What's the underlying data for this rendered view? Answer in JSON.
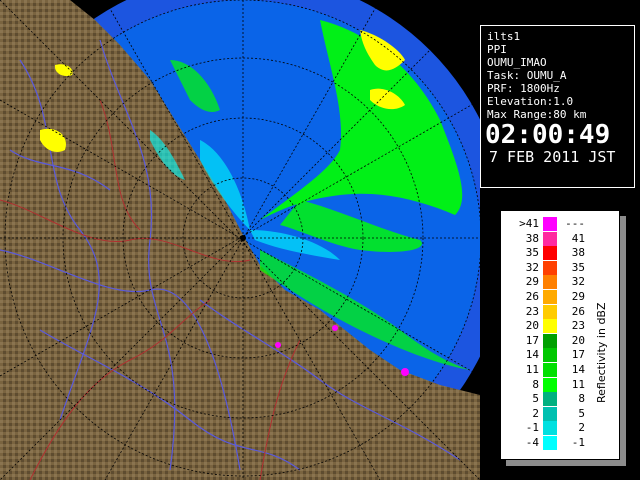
{
  "info": {
    "lines": [
      "ilts1",
      "PPI",
      "OUMU_IMAO",
      "Task: OUMU_A",
      "PRF: 1800Hz",
      "Elevation:1.0",
      "Max Range:80 km"
    ],
    "time": "02:00:49",
    "date": "7 FEB 2011 JST"
  },
  "legend": {
    "title": "Reflectivity in dBZ",
    "rows": [
      {
        "low": ">41",
        "high": "---",
        "color": "#ff00ff"
      },
      {
        "low": "38",
        "high": "41",
        "color": "#ff2aa0"
      },
      {
        "low": "35",
        "high": "38",
        "color": "#ff0000"
      },
      {
        "low": "32",
        "high": "35",
        "color": "#ff4000"
      },
      {
        "low": "29",
        "high": "32",
        "color": "#ff8000"
      },
      {
        "low": "26",
        "high": "29",
        "color": "#ffaa00"
      },
      {
        "low": "23",
        "high": "26",
        "color": "#ffcc00"
      },
      {
        "low": "20",
        "high": "23",
        "color": "#ffff00"
      },
      {
        "low": "17",
        "high": "20",
        "color": "#00a000"
      },
      {
        "low": "14",
        "high": "17",
        "color": "#00c800"
      },
      {
        "low": "11",
        "high": "14",
        "color": "#00e000"
      },
      {
        "low": "8",
        "high": "11",
        "color": "#00ff00"
      },
      {
        "low": "5",
        "high": "8",
        "color": "#00b080"
      },
      {
        "low": "2",
        "high": "5",
        "color": "#00c0b0"
      },
      {
        "low": "-1",
        "high": "2",
        "color": "#00e0e0"
      },
      {
        "low": "-4",
        "high": "-1",
        "color": "#00ffff"
      }
    ]
  },
  "map": {
    "sea_color": "#0a64e8",
    "outer_ring_color": "#1c55e0",
    "land_color": "#7a6440",
    "echo_colors": {
      "weak": "#00ff00",
      "moderate": "#ffff00",
      "clear_air": "#00ffff",
      "strong": "#ff00ff"
    }
  }
}
